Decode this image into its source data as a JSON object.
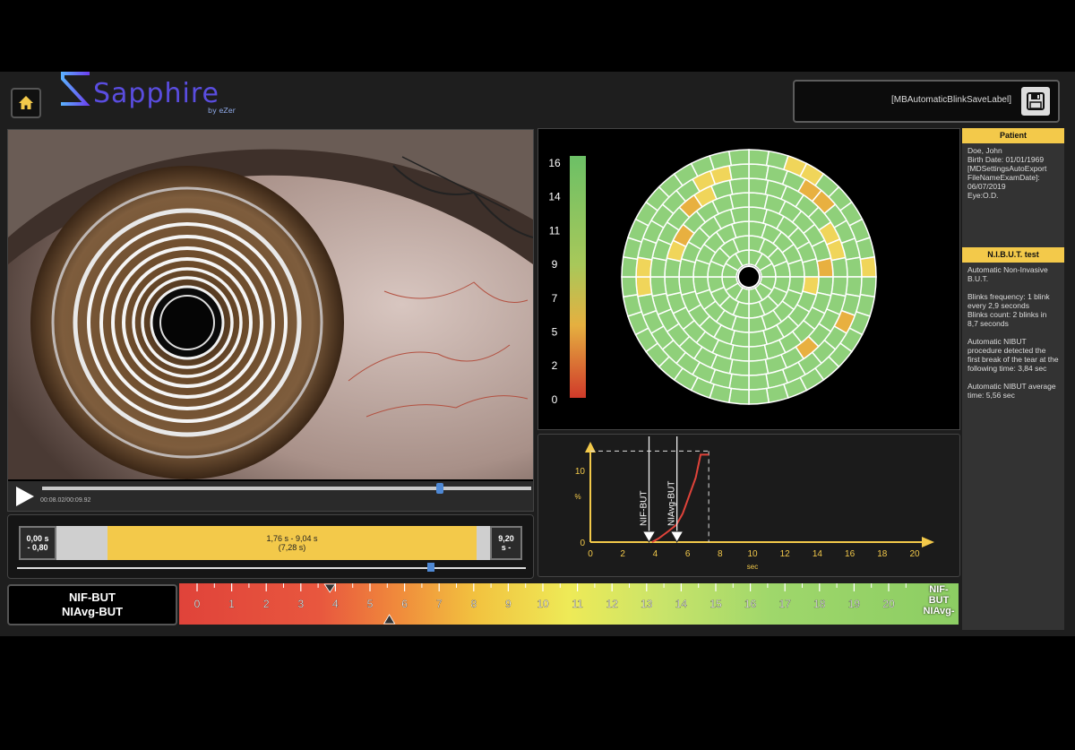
{
  "header": {
    "logo_text": "Sapphire",
    "logo_sub": "by eZer",
    "save_label": "[MBAutomaticBlinkSaveLabel]"
  },
  "video": {
    "time": "00:08.02/00:09.92",
    "progress": 0.81
  },
  "interval": {
    "start_top": "0,00 s",
    "start_bottom": "- 0,80",
    "range": "1,76 s - 9,04 s",
    "duration": "(7,28 s)",
    "end_top": "9,20",
    "end_bottom": "s -"
  },
  "color_scale": {
    "ticks": [
      "16",
      "14",
      "11",
      "9",
      "7",
      "5",
      "2",
      "0"
    ]
  },
  "graph": {
    "y_label": "%",
    "x_label": "sec",
    "x_ticks": [
      "0",
      "2",
      "4",
      "6",
      "8",
      "10",
      "12",
      "14",
      "16",
      "18",
      "20"
    ],
    "y_ticks": [
      "0",
      "10"
    ],
    "nif_but_label": "NIF-BUT",
    "niavg_but_label": "NIAvg-BUT",
    "nif_but_value": 3.84,
    "niavg_but_value": 5.56
  },
  "patient": {
    "header": "Patient",
    "name": "Doe, John",
    "birth": "Birth Date: 01/01/1969",
    "file_label": "[MDSettingsAutoExport FileNameExamDate]:",
    "exam_date": "06/07/2019",
    "eye": "Eye:O.D."
  },
  "nibut": {
    "header": "N.I.B.U.T. test",
    "title": "Automatic Non-Invasive B.U.T.",
    "blinks_freq": "Blinks frequency: 1 blink every 2,9 seconds",
    "blinks_count": "Blinks count: 2 blinks in 8,7 seconds",
    "procedure": "Automatic NIBUT procedure detected the first break of the tear at the following time: 3,84 sec",
    "average": "Automatic NIBUT average time: 5,56 sec"
  },
  "scale": {
    "label_line1": "NIF-BUT",
    "label_line2": "NIAvg-BUT",
    "ticks": [
      "0",
      "1",
      "2",
      "3",
      "4",
      "5",
      "6",
      "7",
      "8",
      "9",
      "10",
      "11",
      "12",
      "13",
      "14",
      "15",
      "16",
      "17",
      "18",
      "19",
      "20"
    ],
    "right_line1": "NIF-",
    "right_line2": "BUT",
    "right_line3": "NIAvg-",
    "nif_value": 3.84,
    "niavg_value": 5.56
  },
  "colors": {
    "accent": "#f3c94a",
    "green": "#8ccd63",
    "red": "#e0433a"
  }
}
